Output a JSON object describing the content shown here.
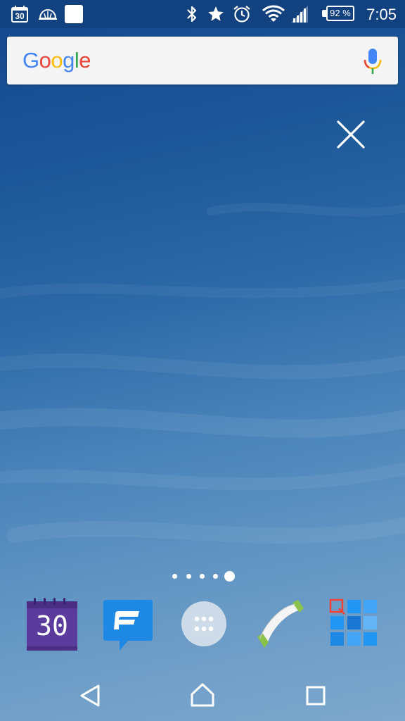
{
  "status_bar": {
    "calendar_date": "30",
    "battery_level": "92 %",
    "time": "7:05",
    "icons": [
      "calendar-notification-icon",
      "cloud-notification-icon",
      "blank-notification-icon",
      "bluetooth-icon",
      "star-icon",
      "alarm-icon",
      "wifi-icon",
      "signal-icon",
      "battery-icon"
    ]
  },
  "search": {
    "logo_letters": [
      "G",
      "o",
      "o",
      "g",
      "l",
      "e"
    ],
    "logo_colors": [
      "#4285f4",
      "#ea4335",
      "#fbbc05",
      "#4285f4",
      "#34a853",
      "#ea4335"
    ],
    "mic_icon": "mic-icon"
  },
  "overlay": {
    "close_icon": "close-icon"
  },
  "pages": {
    "count": 5,
    "active_index": 4
  },
  "dock": {
    "apps": [
      {
        "icon": "calendar-app-icon",
        "date": "30",
        "color": "#5b3c9c"
      },
      {
        "icon": "messaging-app-icon",
        "color": "#1e88e5"
      },
      {
        "icon": "app-drawer-icon",
        "color": "#dfe6ee"
      },
      {
        "icon": "phone-app-icon",
        "color": "#8bc34a"
      },
      {
        "icon": "grid-app-icon",
        "color": "#2196f3"
      }
    ]
  },
  "navigation": {
    "buttons": [
      "back-icon",
      "home-icon",
      "recents-icon"
    ]
  },
  "colors": {
    "status_bar": "#12417f",
    "wallpaper_top": "#14468c",
    "wallpaper_bottom": "#7ea8cd"
  }
}
